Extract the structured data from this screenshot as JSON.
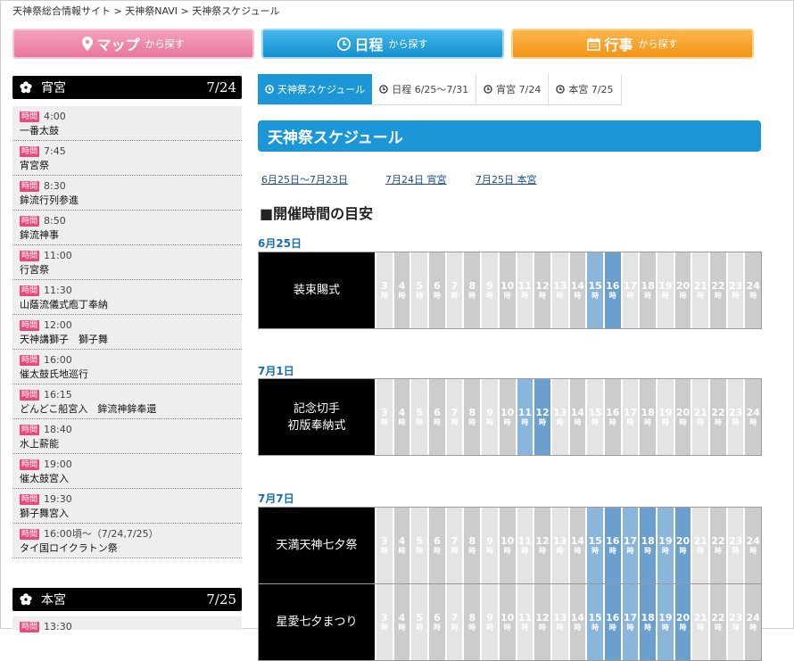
{
  "breadcrumb": {
    "items": [
      "天神祭総合情報サイト",
      "天神祭NAVI",
      "天神祭スケジュール"
    ],
    "separator": ">"
  },
  "nav": {
    "map": {
      "big": "マップ",
      "small": "から探す",
      "icon": "map-pin-icon",
      "color": "#e8779b"
    },
    "schedule": {
      "big": "日程",
      "small": "から探す",
      "icon": "clock-icon",
      "color": "#1591d0"
    },
    "event": {
      "big": "行事",
      "small": "から探す",
      "icon": "calendar-icon",
      "color": "#f39416"
    }
  },
  "sidebar": {
    "badge": "時間",
    "yoimiya": {
      "title": "宵宮",
      "date": "7/24",
      "items": [
        {
          "time": "4:00",
          "name": "一番太鼓"
        },
        {
          "time": "7:45",
          "name": "宵宮祭"
        },
        {
          "time": "8:30",
          "name": "鉾流行列参進"
        },
        {
          "time": "8:50",
          "name": "鉾流神事"
        },
        {
          "time": "11:00",
          "name": "行宮祭"
        },
        {
          "time": "11:30",
          "name": "山蔭流儀式庖丁奉納"
        },
        {
          "time": "12:00",
          "name": "天神講獅子　獅子舞"
        },
        {
          "time": "16:00",
          "name": "催太鼓氏地巡行"
        },
        {
          "time": "16:15",
          "name": "どんどこ船宮入　鉾流神鉾奉還"
        },
        {
          "time": "18:40",
          "name": "水上薪能"
        },
        {
          "time": "19:00",
          "name": "催太鼓宮入"
        },
        {
          "time": "19:30",
          "name": "獅子舞宮入"
        },
        {
          "time": "16:00頃〜（7/24,7/25）",
          "name": "タイ国ロイクラトン祭"
        }
      ]
    },
    "honmiya": {
      "title": "本宮",
      "date": "7/25",
      "first_time": "13:30"
    }
  },
  "tabs": [
    {
      "label": "天神祭スケジュール",
      "active": true
    },
    {
      "label": "日程 6/25〜7/31",
      "active": false
    },
    {
      "label": "宵宮 7/24",
      "active": false
    },
    {
      "label": "本宮 7/25",
      "active": false
    }
  ],
  "main": {
    "title": "天神祭スケジュール",
    "links": [
      "6月25日〜7月23日",
      "7月24日 宵宮",
      "7月25日 本宮"
    ],
    "subheading": "■開催時間の目安",
    "hour_suffix": "時",
    "hours": [
      3,
      4,
      5,
      6,
      7,
      8,
      9,
      10,
      11,
      12,
      13,
      14,
      15,
      16,
      17,
      18,
      19,
      20,
      21,
      22,
      23,
      24
    ],
    "accent_color": "#1b96d6",
    "days": [
      {
        "date": "6月25日",
        "events": [
          {
            "name": [
              "装束賜式"
            ],
            "active": [
              15,
              16
            ]
          }
        ]
      },
      {
        "date": "7月1日",
        "events": [
          {
            "name": [
              "記念切手",
              "初版奉納式"
            ],
            "active": [
              11,
              12
            ]
          }
        ]
      },
      {
        "date": "7月7日",
        "events": [
          {
            "name": [
              "天満天神七夕祭"
            ],
            "active": [
              15,
              16,
              17,
              18,
              19,
              20
            ]
          },
          {
            "name": [
              "星愛七夕まつり"
            ],
            "active": [
              15,
              16,
              17,
              18,
              19,
              20
            ]
          }
        ]
      }
    ]
  }
}
